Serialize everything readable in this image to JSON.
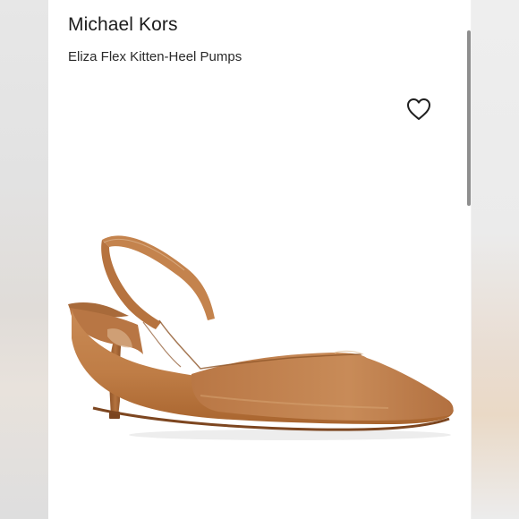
{
  "product": {
    "brand": "Michael Kors",
    "name": "Eliza Flex Kitten-Heel Pumps",
    "image_subject": "tan leather slingback kitten-heel pump",
    "favorite_icon": "heart-outline-icon"
  },
  "colors": {
    "leather": "#c17f4a",
    "leather_dark": "#9a5e2e",
    "heel": "#a8683a",
    "background": "#ffffff",
    "text": "#1c1c1c"
  }
}
